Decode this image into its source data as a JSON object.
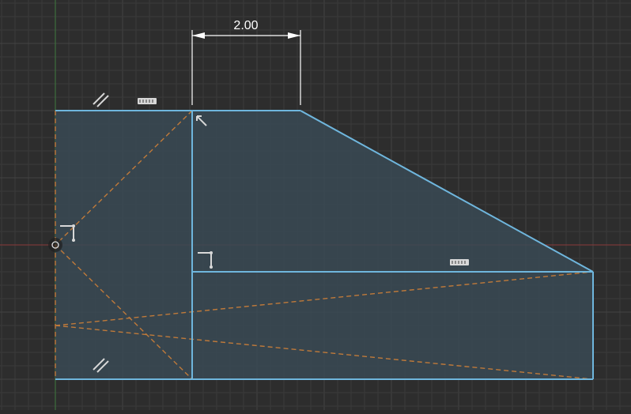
{
  "viewport": {
    "background": "#2d2d2d",
    "grid_minor_color": "#3a3a3a",
    "grid_major_color": "#444444",
    "axis_x_color": "#8b3a3a",
    "axis_y_color": "#3e7a3e"
  },
  "sketch": {
    "profile_color": "#6fb6dd",
    "profile_fill": "#3a4a55",
    "construction_color": "#c07a3a",
    "constraint_color": "#d8d8d8",
    "dimension_color": "#ffffff"
  },
  "dimension": {
    "width_value": "2.00"
  },
  "constraints": {
    "parallel_top": "parallel-constraint",
    "parallel_bottom": "parallel-constraint",
    "horizontal_top": "horizontal-constraint",
    "horizontal_mid": "horizontal-constraint",
    "perpendicular_corner": "perpendicular-constraint",
    "coincident_left": "coincident-constraint",
    "coincident_mid": "coincident-constraint",
    "origin_point": "origin-point"
  }
}
